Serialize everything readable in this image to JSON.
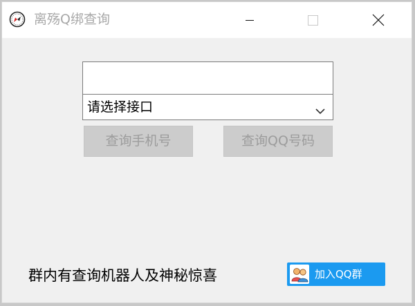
{
  "window": {
    "title": "离殇Q绑查询",
    "icon": "compass-icon"
  },
  "form": {
    "input_value": "",
    "input_placeholder": "",
    "select_value": "请选择接口"
  },
  "buttons": {
    "query_phone": "查询手机号",
    "query_qq": "查询QQ号码"
  },
  "footer": {
    "text": "群内有查询机器人及神秘惊喜",
    "join_group_label": "加入QQ群"
  },
  "colors": {
    "title_text": "#a8a8a8",
    "button_bg": "#cccccc",
    "button_text": "#9c9c9c",
    "qq_blue": "#1b9af0"
  }
}
